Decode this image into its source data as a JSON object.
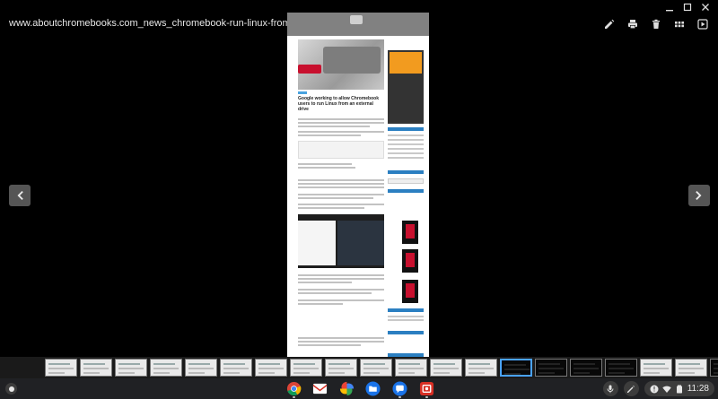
{
  "window": {
    "controls": [
      "minimize-icon",
      "maximize-icon",
      "close-icon"
    ]
  },
  "header": {
    "title": "www.aboutchromebooks.com_news_chromebook-run-linux-from-usb-drive_",
    "toolbar": [
      "edit-icon",
      "print-icon",
      "delete-icon",
      "grid-icon",
      "slideshow-icon"
    ]
  },
  "document": {
    "headline": "Google working to allow Chromebook users to run Linux from an external drive"
  },
  "filmstrip": {
    "thumbnails": [
      {
        "kind": "light"
      },
      {
        "kind": "light"
      },
      {
        "kind": "light"
      },
      {
        "kind": "light"
      },
      {
        "kind": "light"
      },
      {
        "kind": "light"
      },
      {
        "kind": "light"
      },
      {
        "kind": "light"
      },
      {
        "kind": "light"
      },
      {
        "kind": "light"
      },
      {
        "kind": "light"
      },
      {
        "kind": "light"
      },
      {
        "kind": "light"
      },
      {
        "kind": "dark",
        "selected": true
      },
      {
        "kind": "dark"
      },
      {
        "kind": "dark"
      },
      {
        "kind": "dark"
      },
      {
        "kind": "light"
      },
      {
        "kind": "light"
      },
      {
        "kind": "dark"
      }
    ]
  },
  "shelf": {
    "apps": [
      "chrome-icon",
      "gmail-icon",
      "photos-icon",
      "files-icon",
      "messages-icon",
      "screen-recorder-icon"
    ],
    "tray": [
      "microphone-icon",
      "stylus-icon"
    ],
    "status": {
      "icons": [
        "notification-icon",
        "wifi-icon",
        "battery-icon"
      ],
      "time": "11:28"
    }
  },
  "colors": {
    "background": "#000000",
    "shelf": "#202124",
    "accent": "#4aa3ff"
  }
}
